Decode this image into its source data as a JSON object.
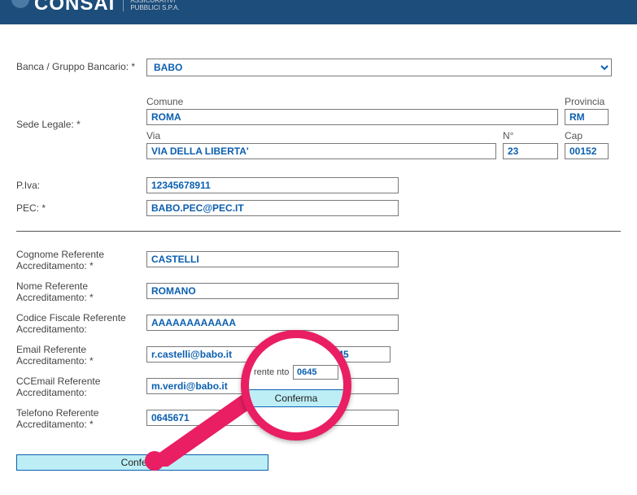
{
  "header": {
    "brand": "CONSAI",
    "sub_line1": "ASSICURATIVI",
    "sub_line2": "PUBBLICI S.P.A."
  },
  "labels": {
    "banca": "Banca / Gruppo Bancario: *",
    "sede": "Sede Legale: *",
    "comune": "Comune",
    "provincia": "Provincia",
    "via": "Via",
    "no": "N°",
    "cap": "Cap",
    "piva": "P.Iva:",
    "pec": "PEC: *",
    "cognome_ref": "Cognome Referente Accreditamento: *",
    "nome_ref": "Nome Referente Accreditamento: *",
    "cf_ref": "Codice Fiscale Referente Accreditamento:",
    "email_ref": "Email Referente Accreditamento: *",
    "ccemail_ref": "CCEmail Referente Accreditamento:",
    "tel_ref": "Telefono Referente Accreditamento: *"
  },
  "values": {
    "banca": "BABO",
    "comune": "ROMA",
    "provincia": "RM",
    "via": "VIA DELLA LIBERTA'",
    "no": "23",
    "cap": "00152",
    "piva": "12345678911",
    "pec": "BABO.PEC@PEC.IT",
    "cognome_ref": "CASTELLI",
    "nome_ref": "ROMANO",
    "cf_ref": "AAAAAAAAAAAA",
    "email_ref": "r.castelli@babo.it",
    "email_ref2": "0645",
    "ccemail_ref": "m.verdi@babo.it",
    "tel_ref": "0645671"
  },
  "buttons": {
    "conferma": "Conferma"
  },
  "lens": {
    "label_frag": "rente nto: *",
    "input_val": "0645",
    "btn": "Conferma"
  }
}
